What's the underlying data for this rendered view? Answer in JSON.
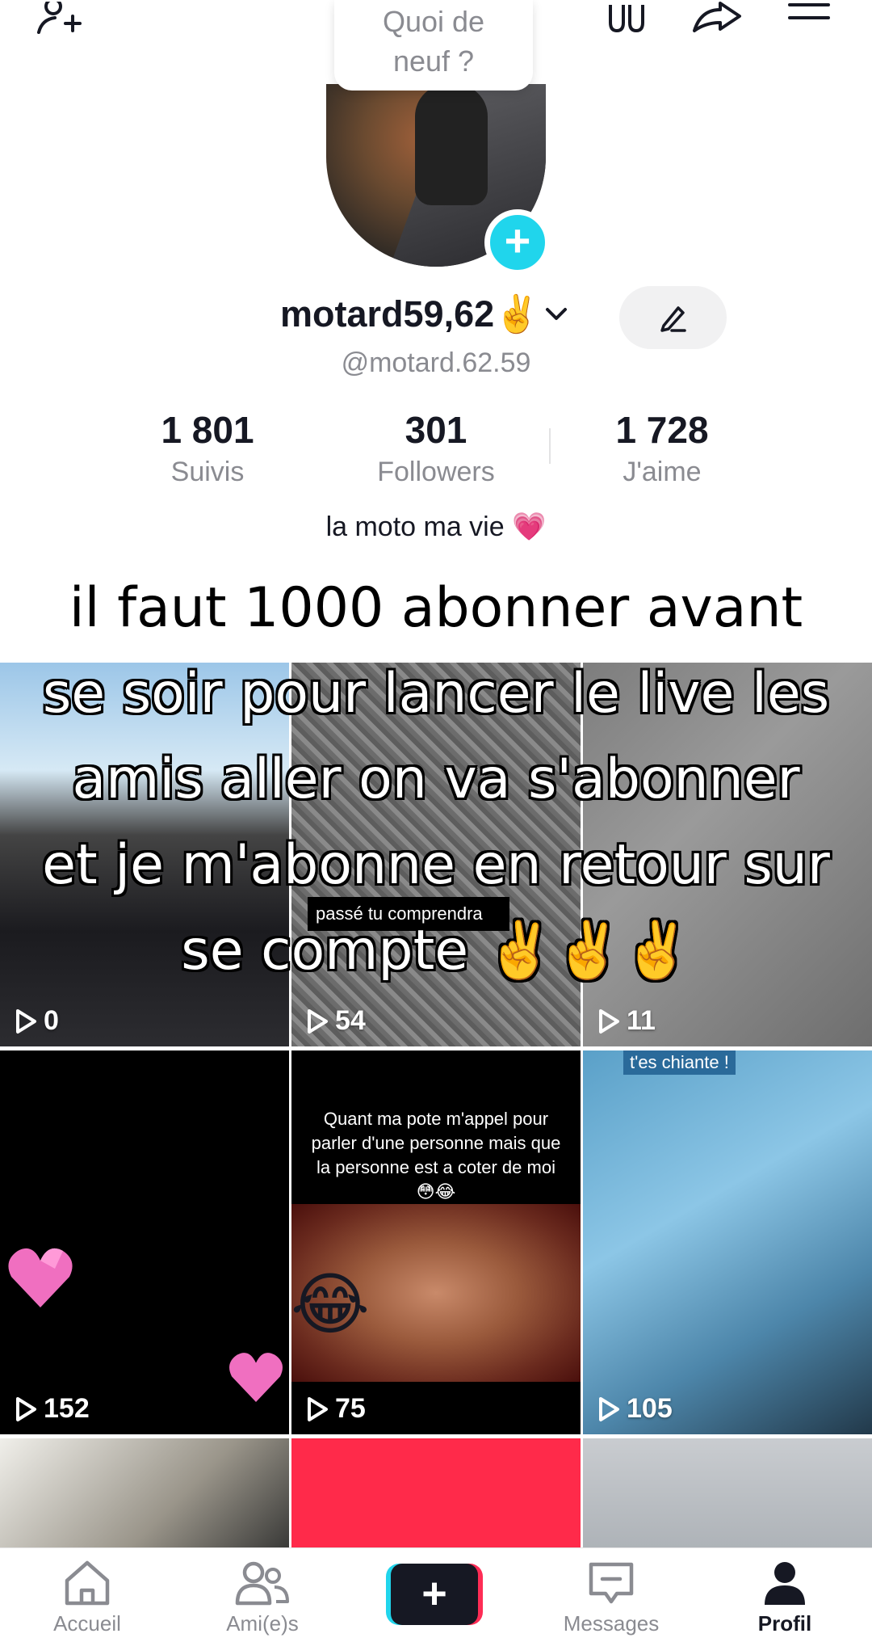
{
  "status_bubble": {
    "line1": "Quoi de",
    "line2": "neuf ?"
  },
  "profile": {
    "display_name": "motard59,62✌️",
    "handle": "@motard.62.59",
    "bio": "la moto ma vie 💗"
  },
  "stats": [
    {
      "value": "1 801",
      "label": "Suivis"
    },
    {
      "value": "301",
      "label": "Followers"
    },
    {
      "value": "1 728",
      "label": "J'aime"
    }
  ],
  "videos": [
    {
      "views": "0"
    },
    {
      "views": "54",
      "caption": "passé tu comprendra"
    },
    {
      "views": "11"
    },
    {
      "views": "152"
    },
    {
      "views": "75",
      "caption": "Quant ma pote m'appel pour parler d'une personne mais que la personne est a coter de moi 😳😂"
    },
    {
      "views": "105",
      "caption": "t'es chiante !"
    }
  ],
  "overlay_text": {
    "line0": "il faut 1000 abonner avant",
    "line1": "se soir pour lancer le live les",
    "line2": "amis aller on va s'abonner",
    "line3": "et je m'abonne en retour sur",
    "line4": "se compte ✌️✌️✌️"
  },
  "nav": {
    "home": "Accueil",
    "friends": "Ami(e)s",
    "create": "+",
    "messages": "Messages",
    "profile": "Profil"
  },
  "colors": {
    "accent_cyan": "#20d5ec",
    "accent_red": "#fe2c55",
    "text_primary": "#161823",
    "text_secondary": "#8a8b91"
  }
}
